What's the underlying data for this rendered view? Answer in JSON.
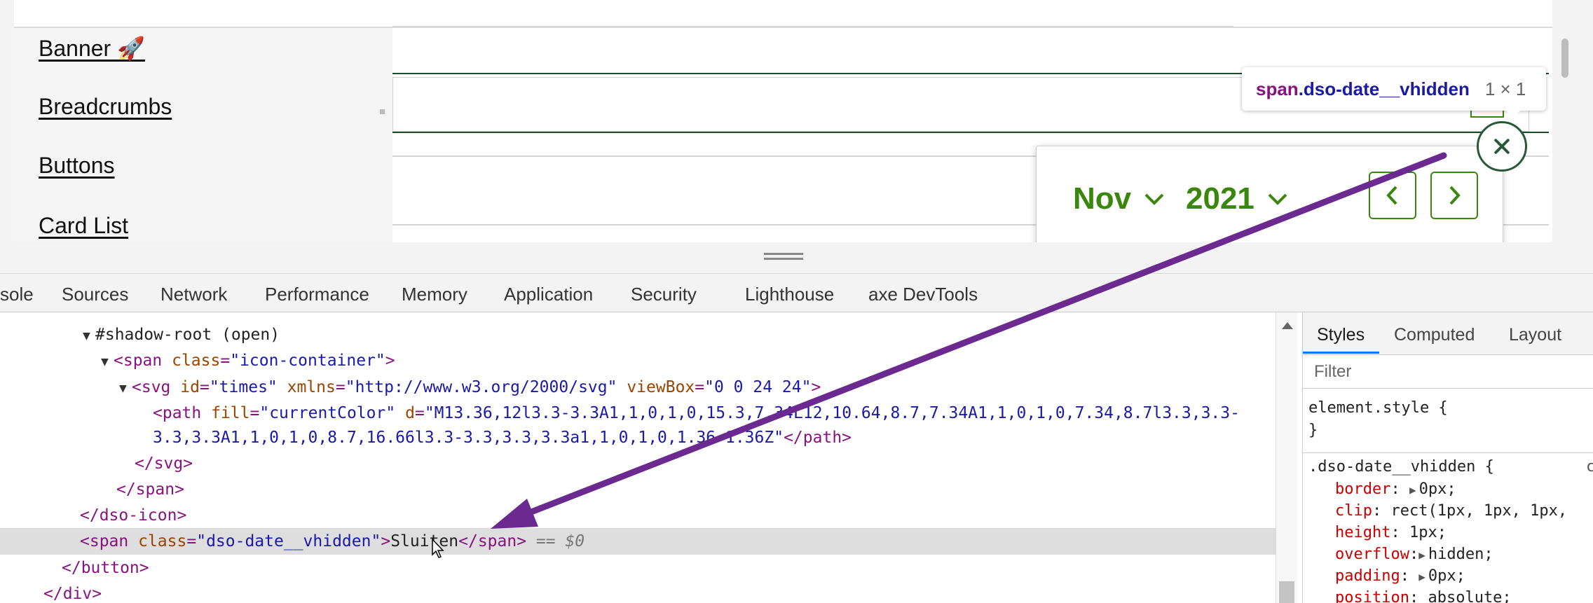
{
  "preview": {
    "nav_items": [
      "Banner 🚀",
      "Breadcrumbs",
      "Buttons",
      "Card List"
    ],
    "datepicker": {
      "month": "Nov",
      "year": "2021"
    },
    "tooltip": {
      "tag": "span",
      "class_name": ".dso-date__vhidden",
      "size": "1 × 1"
    },
    "accent_color": "#39870c"
  },
  "devtools_tabs": [
    "sole",
    "Sources",
    "Network",
    "Performance",
    "Memory",
    "Application",
    "Security",
    "Lighthouse",
    "axe DevTools"
  ],
  "dom": {
    "shadow_root": "#shadow-root (open)",
    "span_tag": "span",
    "class_attr": "class",
    "icon_container": "\"icon-container\"",
    "svg_tag": "svg",
    "id_attr": "id",
    "svg_id": "\"times\"",
    "xmlns_attr": "xmlns",
    "xmlns_val": "\"http://www.w3.org/2000/svg\"",
    "viewbox_attr": "viewBox",
    "viewbox_val": "\"0 0 24 24\"",
    "path_tag": "path",
    "fill_attr": "fill",
    "fill_val": "\"currentColor\"",
    "d_attr": "d",
    "d_val_1": "\"M13.36,12l3.3-3.3A1,1,0,1,0,15.3,7.34L12,10.64,8.7,7.34A1,1,0,1,0,7.34,8.7l3.3,3.3-",
    "d_val_2": "3.3,3.3A1,1,0,1,0,8.7,16.66l3.3-3.3,3.3,3.3a1,1,0,1,0,1.36-1.36Z\"",
    "close_path": "</path>",
    "close_svg": "</svg>",
    "close_span": "</span>",
    "close_icon": "</dso-icon>",
    "vhidden_class": "\"dso-date__vhidden\"",
    "vhidden_text": "Sluiten",
    "selected_marker": "== $0",
    "close_button": "</button>",
    "close_div": "</div>"
  },
  "styles": {
    "tabs": [
      "Styles",
      "Computed",
      "Layout"
    ],
    "filter_placeholder": "Filter",
    "element_style_open": "element.style {",
    "element_style_close": "}",
    "rule_selector": ".dso-date__vhidden {",
    "rule_source": "c",
    "declarations": [
      {
        "prop": "border",
        "value": "0px;",
        "expandable": true
      },
      {
        "prop": "clip",
        "value": "rect(1px, 1px, 1px,",
        "expandable": false
      },
      {
        "prop": "height",
        "value": "1px;",
        "expandable": false
      },
      {
        "prop": "overflow",
        "value": "hidden;",
        "expandable": true
      },
      {
        "prop": "padding",
        "value": "0px;",
        "expandable": true
      },
      {
        "prop": "position",
        "value": "absolute;",
        "expandable": false
      }
    ]
  },
  "annotation_color": "#6b2a8f"
}
